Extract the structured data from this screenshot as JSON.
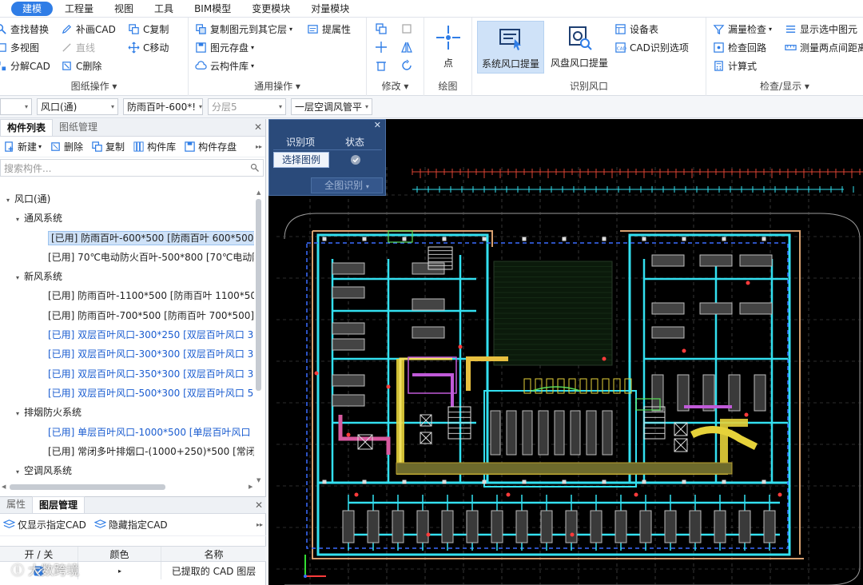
{
  "menu": [
    "建模",
    "工程量",
    "视图",
    "工具",
    "BIM模型",
    "变更模块",
    "对量模块"
  ],
  "ribbon": {
    "drawing_ops": {
      "title": "图纸操作",
      "btns": [
        "查找替换",
        "补画CAD",
        "C复制",
        "多视图",
        "直线",
        "C移动",
        "分解CAD",
        "C删除"
      ]
    },
    "common_ops": {
      "title": "通用操作",
      "btns": [
        "复制图元到其它层",
        "提属性",
        "图元存盘",
        "云构件库"
      ]
    },
    "modify": {
      "title": "修改"
    },
    "draw": {
      "title": "绘图",
      "point": "点"
    },
    "recognize": {
      "title": "识别风口",
      "system_vent": "系统风口提量",
      "fan_coil_vent": "风盘风口提量",
      "device_table": "设备表",
      "cad_options": "CAD识别选项"
    },
    "check": {
      "title": "检查/显示",
      "btns": [
        "漏量检查",
        "显示选中图元",
        "检查回路",
        "测量两点间距离",
        "计算式"
      ]
    }
  },
  "filters": [
    "",
    "风口(通)",
    "防雨百叶-600*!",
    "分层5",
    "一层空调风管平"
  ],
  "left_panel": {
    "tabs": [
      "构件列表",
      "图纸管理"
    ],
    "toolbar": [
      "新建",
      "删除",
      "复制",
      "构件库",
      "构件存盘"
    ],
    "search_placeholder": "搜索构件...",
    "tree": [
      {
        "level": 0,
        "text": "风口(通)",
        "toggle": true,
        "style": ""
      },
      {
        "level": 1,
        "text": "通风系统",
        "toggle": true,
        "style": ""
      },
      {
        "level": 2,
        "text": "[已用] 防雨百叶-600*500 [防雨百叶 600*500]",
        "toggle": false,
        "style": "sel"
      },
      {
        "level": 2,
        "text": "[已用] 70℃电动防火百叶-500*800 [70℃电动防",
        "toggle": false,
        "style": ""
      },
      {
        "level": 1,
        "text": "新风系统",
        "toggle": true,
        "style": ""
      },
      {
        "level": 2,
        "text": "[已用] 防雨百叶-1100*500 [防雨百叶 1100*500",
        "toggle": false,
        "style": ""
      },
      {
        "level": 2,
        "text": "[已用] 防雨百叶-700*500 [防雨百叶 700*500]",
        "toggle": false,
        "style": ""
      },
      {
        "level": 2,
        "text": "[已用] 双层百叶风口-300*250 [双层百叶风口 3",
        "toggle": false,
        "style": "blue"
      },
      {
        "level": 2,
        "text": "[已用] 双层百叶风口-300*300 [双层百叶风口 3",
        "toggle": false,
        "style": "blue"
      },
      {
        "level": 2,
        "text": "[已用] 双层百叶风口-350*300 [双层百叶风口 3",
        "toggle": false,
        "style": "blue"
      },
      {
        "level": 2,
        "text": "[已用] 双层百叶风口-500*300 [双层百叶风口 5",
        "toggle": false,
        "style": "blue"
      },
      {
        "level": 1,
        "text": "排烟防火系统",
        "toggle": true,
        "style": ""
      },
      {
        "level": 2,
        "text": "[已用] 单层百叶风口-1000*500 [单层百叶风口 ",
        "toggle": false,
        "style": "blue"
      },
      {
        "level": 2,
        "text": "[已用] 常闭多叶排烟口-(1000+250)*500 [常闭",
        "toggle": false,
        "style": ""
      },
      {
        "level": 1,
        "text": "空调风系统",
        "toggle": true,
        "style": ""
      }
    ]
  },
  "lower_panel": {
    "tabs": [
      "属性",
      "图层管理"
    ],
    "toolbar": [
      "仅显示指定CAD",
      "隐藏指定CAD"
    ],
    "columns": [
      "开 / 关",
      "颜色",
      "名称"
    ],
    "row": {
      "name": "已提取的 CAD 图层"
    }
  },
  "float_dialog": {
    "col1": "识别项",
    "col2": "状态",
    "select_legend": "选择图例",
    "full_recognize": "全图识别"
  },
  "watermark": "大数跨境",
  "colors": {
    "accent": "#2f7de6",
    "canvas_bg": "#000000",
    "cyan_duct": "#33e0f0",
    "yellow_duct": "#e6d23a"
  }
}
